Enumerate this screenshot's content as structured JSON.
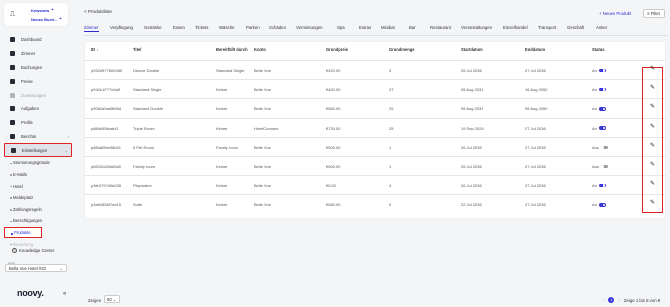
{
  "hotel_card": {
    "line1": "Kewsbew",
    "line2": "Neuse Buch..."
  },
  "nav": {
    "items": [
      {
        "label": "Dashboard",
        "muted": false
      },
      {
        "label": "Zimmer",
        "muted": false
      },
      {
        "label": "Buchungen",
        "muted": false
      },
      {
        "label": "Preise",
        "muted": false
      },
      {
        "label": "Zuweisungen",
        "muted": true
      },
      {
        "label": "Aufgaben",
        "muted": false
      },
      {
        "label": "Profile",
        "muted": false
      },
      {
        "label": "Berichte",
        "muted": false
      }
    ],
    "settings": "Einstellungen",
    "settings_sub": [
      "Stornierungsgründe",
      "E-Mails",
      "Hotel",
      "Meldeplatz",
      "Zahlungsregeln",
      "Berechtigungen"
    ],
    "current": "Produkte",
    "faded": "Bewertung",
    "knowledge": "Knowledge Center",
    "hotel_label": "Hotel",
    "hotel_value": "Bella Vue Hotel #23",
    "brand": "noovy."
  },
  "header": {
    "back": "< Produktliste",
    "new_product": "+ Neues Produkt",
    "filter": "Filter"
  },
  "tabs": [
    "Zimmer",
    "Verpflegung",
    "Getränke",
    "Essen",
    "Tickets",
    "Wäsche",
    "Parken",
    "Schäden",
    "Vermietungen",
    "Spa",
    "Extras",
    "Minibar",
    "Bar",
    "Restaurant",
    "Veranstaltungen",
    "Einzelhandel",
    "Transport",
    "Geschäft",
    "Anker"
  ],
  "active_tab": "Zimmer",
  "table": {
    "columns": [
      "ID ↓",
      "Titel",
      "Bereitfüllt durch",
      "Konto",
      "Grundpreis",
      "Grundmenge",
      "Startdatum",
      "Enddatum",
      "Status"
    ],
    "rows": [
      {
        "id": "p932d977800450",
        "title": "Deluxe Double",
        "by": "Standard Single",
        "account": "Belle Vue",
        "price": "€420.00",
        "qty": "3",
        "start": "26 Jul 2036",
        "end": "27 Jul 2036",
        "status": "An",
        "on": true
      },
      {
        "id": "p932e1F77d4a9",
        "title": "Standard Single",
        "by": "Keiner",
        "account": "Belle Vue",
        "price": "€400.00",
        "qty": "27",
        "start": "05 Aug 2031",
        "end": "16 Aug 2052",
        "status": "An",
        "on": true
      },
      {
        "id": "p9060a9ad5f68d",
        "title": "Standard Double",
        "by": "Keiner",
        "account": "Belle Vue",
        "price": "€560.00",
        "qty": "25",
        "start": "05 Aug 2031",
        "end": "05 Aug 2050",
        "status": "An",
        "on": true
      },
      {
        "id": "p8f8b0f5fcab41",
        "title": "Triple Room",
        "by": "Keiner",
        "account": "HotelConnect",
        "price": "€720.00",
        "qty": "25",
        "start": "19 Sep 2024",
        "end": "27 Jul 2036",
        "status": "An",
        "on": true
      },
      {
        "id": "p8f5a89be58b01",
        "title": "5 Pet Room",
        "by": "Family room",
        "account": "Belle Vue",
        "price": "€500.00",
        "qty": "1",
        "start": "26 Jul 2036",
        "end": "27 Jul 2036",
        "status": "Aus",
        "on": false
      },
      {
        "id": "p6f242d2bb65d0",
        "title": "Family room",
        "by": "Keiner",
        "account": "Belle Vue",
        "price": "€500.00",
        "qty": "1",
        "start": "26 Jul 2036",
        "end": "27 Jul 2036",
        "status": "Aus",
        "on": false
      },
      {
        "id": "p3fe3797d0b028",
        "title": "Playmaker",
        "by": "Keiner",
        "account": "Belle Vue",
        "price": "€0.00",
        "qty": "4",
        "start": "26 Jul 2036",
        "end": "27 Jul 2036",
        "status": "An",
        "on": true
      },
      {
        "id": "p3a60856f7ea15",
        "title": "Suite",
        "by": "Keiner",
        "account": "Belle Vue",
        "price": "€580.00",
        "qty": "0",
        "start": "22 Jul 2036",
        "end": "27 Jul 2036",
        "status": "An",
        "on": true
      }
    ]
  },
  "footer": {
    "rows_label": "Zeigen",
    "rows_value": "50",
    "page": "1",
    "info": "Zeige 1 bis 8 von 8"
  }
}
